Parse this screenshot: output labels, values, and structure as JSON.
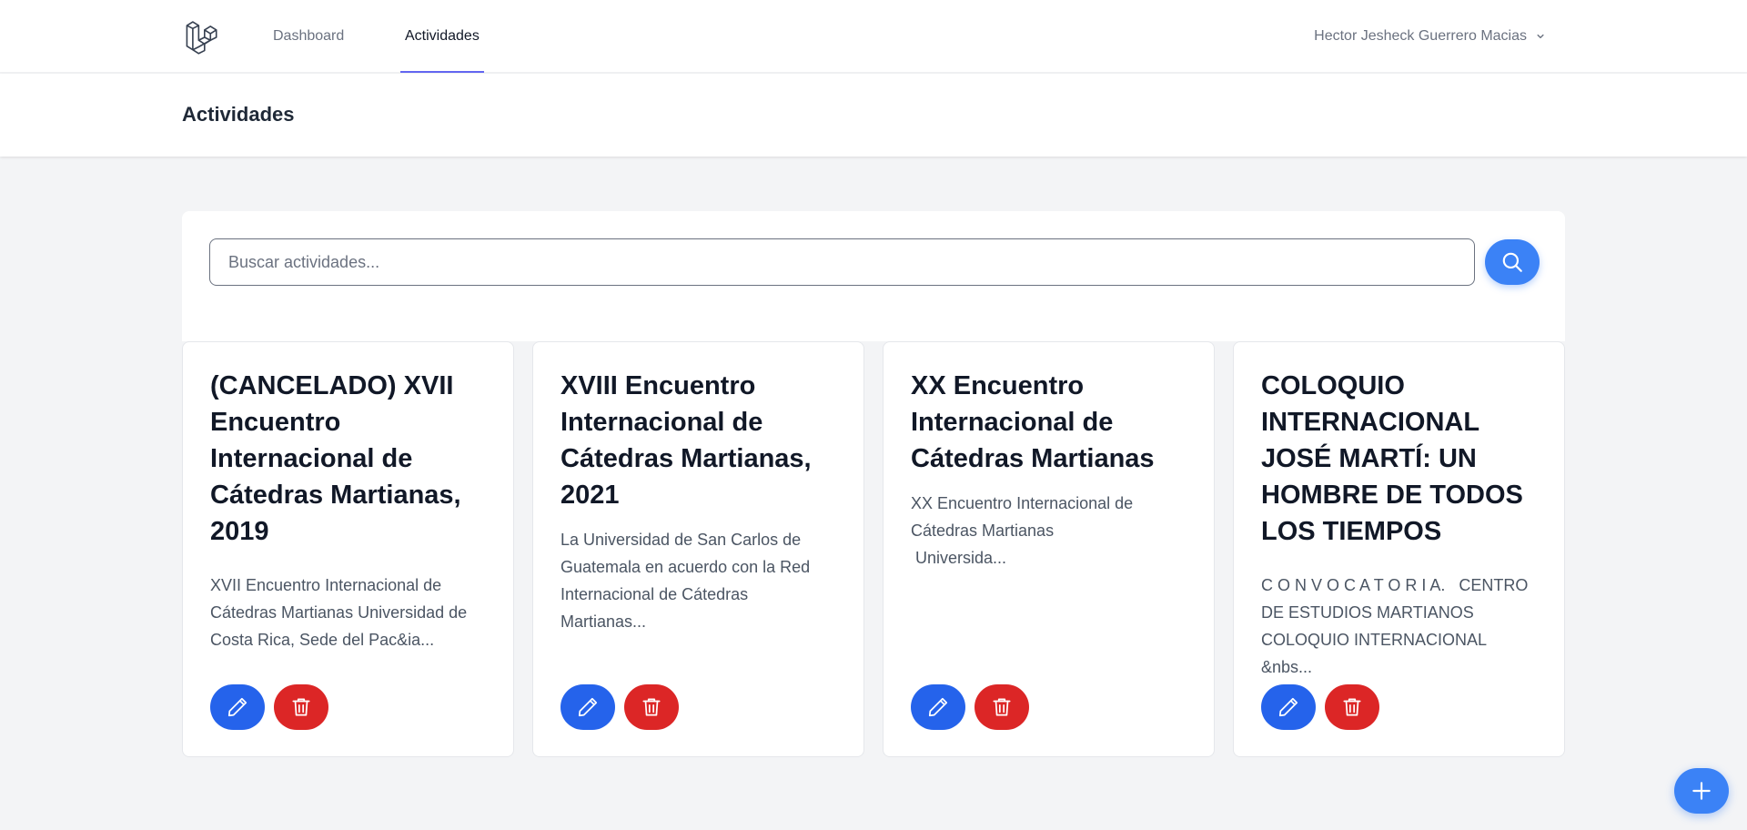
{
  "nav": {
    "logo_icon": "laravel-logo-icon",
    "links": [
      {
        "label": "Dashboard",
        "active": false
      },
      {
        "label": "Actividades",
        "active": true
      }
    ],
    "user_name": "Hector Jesheck Guerrero Macias",
    "user_menu_icon": "chevron-down-icon"
  },
  "header": {
    "title": "Actividades"
  },
  "search": {
    "placeholder": "Buscar actividades...",
    "value": "",
    "button_icon": "search-icon"
  },
  "cards": [
    {
      "title": "(CANCELADO) XVII Encuentro Internacional de Cátedras Martianas, 2019",
      "description": "XVII Encuentro Internacional de Cátedras Martianas Universidad de Costa Rica, Sede del Pac&ia..."
    },
    {
      "title": "XVIII Encuentro Internacional de Cátedras Martianas, 2021",
      "description": "La Universidad de San Carlos de Guatemala en acuerdo con la Red Internacional de Cátedras Martianas..."
    },
    {
      "title": "XX Encuentro Internacional de Cátedras Martianas",
      "description": "XX Encuentro Internacional de Cátedras Martianas\n Universida..."
    },
    {
      "title": "COLOQUIO INTERNACIONAL JOSÉ MARTÍ: UN HOMBRE DE TODOS LOS TIEMPOS",
      "description": "C O N V O C A T O R I A.   CENTRO DE ESTUDIOS MARTIANOS   COLOQUIO INTERNACIONAL &nbs..."
    }
  ],
  "actions": {
    "edit_icon": "pencil-icon",
    "delete_icon": "trash-icon",
    "add_icon": "plus-icon"
  },
  "colors": {
    "primary": "#3b82f6",
    "edit": "#2563eb",
    "delete": "#dc2626",
    "nav_active_underline": "#6366f1",
    "background": "#f3f4f6"
  }
}
